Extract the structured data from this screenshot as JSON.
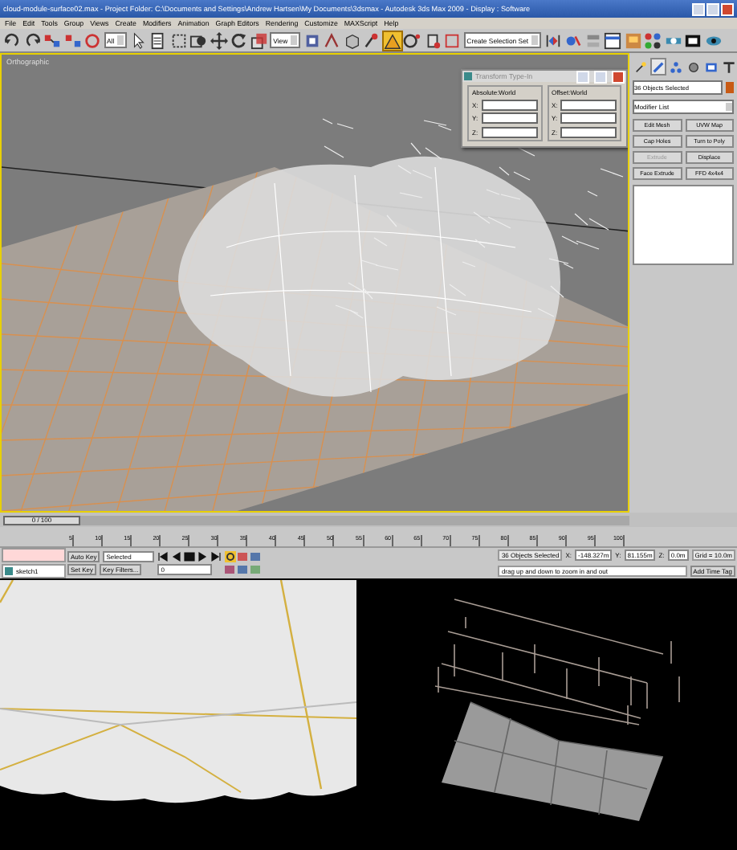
{
  "window": {
    "title": "cloud-module-surface02.max  - Project Folder: C:\\Documents and Settings\\Andrew Hartsen\\My Documents\\3dsmax  - Autodesk 3ds Max 2009  - Display : Software"
  },
  "menu": [
    "File",
    "Edit",
    "Tools",
    "Group",
    "Views",
    "Create",
    "Modifiers",
    "Animation",
    "Graph Editors",
    "Rendering",
    "Customize",
    "MAXScript",
    "Help"
  ],
  "toolbar": [
    {
      "kind": "undo",
      "on": false
    },
    {
      "kind": "redo",
      "on": false
    },
    {
      "kind": "link",
      "on": false
    },
    {
      "kind": "unlink",
      "on": false
    },
    {
      "kind": "bind",
      "on": false
    },
    {
      "kind": "dropdown",
      "value": "All"
    },
    {
      "kind": "select",
      "on": false
    },
    {
      "kind": "select-name",
      "on": false
    },
    {
      "kind": "region",
      "on": false
    },
    {
      "kind": "window",
      "on": false
    },
    {
      "kind": "move",
      "on": false
    },
    {
      "kind": "rotate",
      "on": false
    },
    {
      "kind": "scale",
      "on": false
    },
    {
      "kind": "dropdown",
      "value": "View"
    },
    {
      "kind": "pivot",
      "on": false
    },
    {
      "kind": "manipulate",
      "on": false
    },
    {
      "kind": "keyboard",
      "on": false
    },
    {
      "kind": "snap",
      "on": false
    },
    {
      "kind": "angle-snap",
      "on": true
    },
    {
      "kind": "percent-snap",
      "on": false
    },
    {
      "kind": "spinner-snap",
      "on": false
    },
    {
      "kind": "edit-sets",
      "on": false
    },
    {
      "kind": "dropdown",
      "value": "Create Selection Set"
    },
    {
      "kind": "mirror",
      "on": false
    },
    {
      "kind": "align",
      "on": false
    },
    {
      "kind": "layers",
      "on": false
    },
    {
      "kind": "curve",
      "on": false
    },
    {
      "kind": "schematic",
      "on": false
    },
    {
      "kind": "material",
      "on": false
    },
    {
      "kind": "render-setup",
      "on": false
    },
    {
      "kind": "render-frame",
      "on": false
    },
    {
      "kind": "render",
      "on": false
    }
  ],
  "viewport": {
    "label": "Orthographic"
  },
  "transform_dialog": {
    "title": "Transform Type-In",
    "groups": [
      {
        "label": "Absolute:World",
        "axes": [
          "X:",
          "Y:",
          "Z:"
        ]
      },
      {
        "label": "Offset:World",
        "axes": [
          "X:",
          "Y:",
          "Z:"
        ]
      }
    ]
  },
  "command_panel": {
    "tabs": [
      {
        "kind": "create",
        "selected": false
      },
      {
        "kind": "modify",
        "selected": true
      },
      {
        "kind": "hierarchy",
        "selected": false
      },
      {
        "kind": "motion",
        "selected": false
      },
      {
        "kind": "display",
        "selected": false
      },
      {
        "kind": "utilities",
        "selected": false
      }
    ],
    "selection": "36 Objects Selected",
    "color": "#c85a14",
    "modifier_list": "Modifier List",
    "buttons": [
      {
        "label": "Edit Mesh",
        "disabled": false
      },
      {
        "label": "UVW Map",
        "disabled": false
      },
      {
        "label": "Cap Holes",
        "disabled": false
      },
      {
        "label": "Turn to Poly",
        "disabled": false
      },
      {
        "label": "Extrude",
        "disabled": true
      },
      {
        "label": "Displace",
        "disabled": false
      },
      {
        "label": "Face Extrude",
        "disabled": false
      },
      {
        "label": "FFD 4x4x4",
        "disabled": false
      }
    ]
  },
  "timeline": {
    "position": "0 / 100",
    "level": 0,
    "ticks": [
      "5",
      "10",
      "15",
      "20",
      "25",
      "30",
      "35",
      "40",
      "45",
      "50",
      "55",
      "60",
      "65",
      "70",
      "75",
      "80",
      "85",
      "90",
      "95",
      "100"
    ]
  },
  "status": {
    "listener": "sketch1",
    "selection": "36 Objects Selected",
    "prompt": "drag up and down to zoom in and out",
    "x_label": "X:",
    "x": "-148.327m",
    "y_label": "Y:",
    "y": "81.155m",
    "z_label": "Z:",
    "z": "0.0m",
    "grid": "Grid = 10.0m",
    "add_time_tag": "Add Time Tag",
    "auto_key": "Auto Key",
    "key_mode": "Selected",
    "set_key": "Set Key",
    "key_filters": "Key Filters...",
    "frame": "0"
  }
}
